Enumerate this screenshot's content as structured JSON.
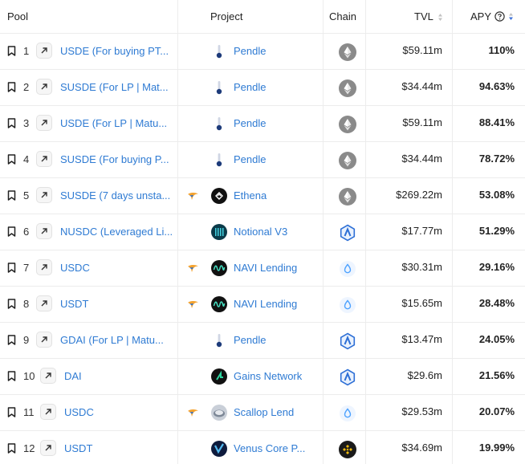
{
  "header": {
    "pool": "Pool",
    "project": "Project",
    "chain": "Chain",
    "tvl": "TVL",
    "apy": "APY"
  },
  "rows": [
    {
      "num": "1",
      "pool": "USDE (For buying PT...",
      "bird": false,
      "project": "Pendle",
      "logo": "pendle-logo",
      "chain": "ethereum",
      "tvl": "$59.11m",
      "apy": "110%"
    },
    {
      "num": "2",
      "pool": "SUSDE (For LP | Mat...",
      "bird": false,
      "project": "Pendle",
      "logo": "pendle-logo",
      "chain": "ethereum",
      "tvl": "$34.44m",
      "apy": "94.63%"
    },
    {
      "num": "3",
      "pool": "USDE (For LP | Matu...",
      "bird": false,
      "project": "Pendle",
      "logo": "pendle-logo",
      "chain": "ethereum",
      "tvl": "$59.11m",
      "apy": "88.41%"
    },
    {
      "num": "4",
      "pool": "SUSDE (For buying P...",
      "bird": false,
      "project": "Pendle",
      "logo": "pendle-logo",
      "chain": "ethereum",
      "tvl": "$34.44m",
      "apy": "78.72%"
    },
    {
      "num": "5",
      "pool": "SUSDE (7 days unsta...",
      "bird": true,
      "project": "Ethena",
      "logo": "ethena-logo",
      "chain": "ethereum",
      "tvl": "$269.22m",
      "apy": "53.08%"
    },
    {
      "num": "6",
      "pool": "NUSDC (Leveraged Li...",
      "bird": false,
      "project": "Notional V3",
      "logo": "notional-logo",
      "chain": "arbitrum",
      "tvl": "$17.77m",
      "apy": "51.29%"
    },
    {
      "num": "7",
      "pool": "USDC",
      "bird": true,
      "project": "NAVI Lending",
      "logo": "navi-logo",
      "chain": "sui",
      "tvl": "$30.31m",
      "apy": "29.16%"
    },
    {
      "num": "8",
      "pool": "USDT",
      "bird": true,
      "project": "NAVI Lending",
      "logo": "navi-logo",
      "chain": "sui",
      "tvl": "$15.65m",
      "apy": "28.48%"
    },
    {
      "num": "9",
      "pool": "GDAI (For LP | Matu...",
      "bird": false,
      "project": "Pendle",
      "logo": "pendle-logo",
      "chain": "arbitrum",
      "tvl": "$13.47m",
      "apy": "24.05%"
    },
    {
      "num": "10",
      "pool": "DAI",
      "bird": false,
      "project": "Gains Network",
      "logo": "gains-logo",
      "chain": "arbitrum",
      "tvl": "$29.6m",
      "apy": "21.56%"
    },
    {
      "num": "11",
      "pool": "USDC",
      "bird": true,
      "project": "Scallop Lend",
      "logo": "scallop-logo",
      "chain": "sui",
      "tvl": "$29.53m",
      "apy": "20.07%"
    },
    {
      "num": "12",
      "pool": "USDT",
      "bird": false,
      "project": "Venus Core P...",
      "logo": "venus-logo",
      "chain": "bsc",
      "tvl": "$34.69m",
      "apy": "19.99%"
    }
  ],
  "colors": {
    "link": "#2f7bd3",
    "sort_accent": "#3b6fd8",
    "arbitrum": "#2d6fd6",
    "sui": "#4da2ff",
    "ethereum_bg": "#8a8a8a",
    "bsc": "#f0b90b"
  }
}
